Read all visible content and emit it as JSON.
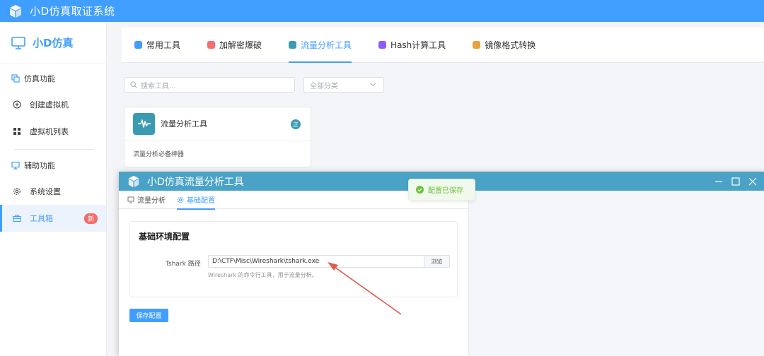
{
  "app": {
    "title": "小D仿真取证系统"
  },
  "sidebar": {
    "brand": "小D仿真",
    "section1": "仿真功能",
    "items1": [
      {
        "label": "创建虚拟机"
      },
      {
        "label": "虚拟机列表"
      }
    ],
    "section2": "辅助功能",
    "items2": [
      {
        "label": "系统设置"
      },
      {
        "label": "工具箱",
        "badge": "新"
      }
    ]
  },
  "tabs": [
    {
      "label": "常用工具",
      "color": "#409eff"
    },
    {
      "label": "加解密爆破",
      "color": "#f56c6c"
    },
    {
      "label": "流量分析工具",
      "color": "#3a9bb0"
    },
    {
      "label": "Hash计算工具",
      "color": "#8e5cf7"
    },
    {
      "label": "镜像格式转换",
      "color": "#e6a23c"
    }
  ],
  "search": {
    "placeholder": "搜索工具..."
  },
  "filter": {
    "value": "全部分类"
  },
  "card": {
    "title": "流量分析工具",
    "tag": "正",
    "desc": "流量分析必备神器"
  },
  "window": {
    "title": "小D仿真流量分析工具",
    "tabs": [
      {
        "label": "流量分析"
      },
      {
        "label": "基础配置"
      }
    ],
    "config": {
      "heading": "基础环境配置",
      "label": "Tshark 路径",
      "value": "D:\\CTF\\Misc\\Wireshark\\tshark.exe",
      "browse": "浏览",
      "hint": "Wireshark 的命令行工具，用于流量分析。"
    },
    "save": "保存配置"
  },
  "toast": {
    "text": "配置已保存"
  }
}
